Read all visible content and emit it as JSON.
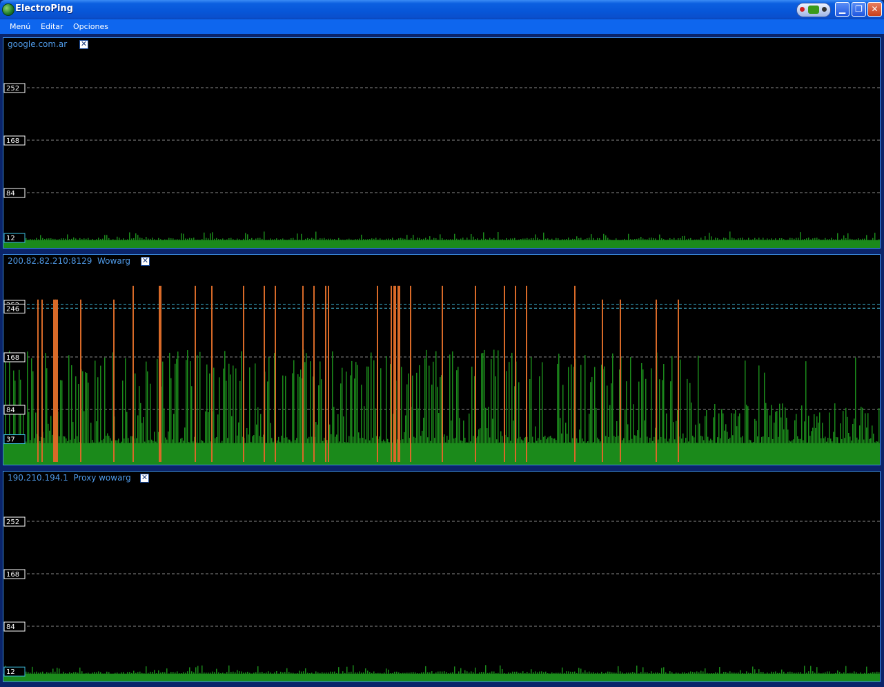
{
  "window": {
    "title": "ElectroPing",
    "minimize_glyph": "▁",
    "restore_glyph": "❐",
    "close_glyph": "✕"
  },
  "menu": [
    {
      "label": "Menú"
    },
    {
      "label": "Editar"
    },
    {
      "label": "Opciones"
    }
  ],
  "colors": {
    "accent": "#3c8ee8",
    "bar_green": "#1b8a1b",
    "spike_orange": "#d86a28",
    "grid": "#8a8a8a",
    "cyan_line": "#3bb8d8"
  },
  "panels": [
    {
      "title": "google.com.ar",
      "close_glyph": "✕",
      "chart_data": {
        "type": "bar",
        "y_ticks": [
          252,
          168,
          84
        ],
        "current_value": 12,
        "baseline_ms": 8,
        "spike_ms": [],
        "cyan_levels": []
      }
    },
    {
      "title": "200.82.82.210:8129  Wowarg",
      "close_glyph": "✕",
      "chart_data": {
        "type": "bar",
        "y_ticks": [
          252,
          246,
          168,
          84
        ],
        "current_value": 37,
        "baseline_ms": 30,
        "spike_ms": [
          282,
          282,
          282,
          282,
          282,
          282,
          282,
          282,
          282,
          282,
          282,
          282,
          282,
          282,
          282,
          282,
          282,
          282,
          282,
          282,
          282,
          282,
          282,
          282,
          282,
          282,
          282,
          282,
          282
        ],
        "cyan_levels": [
          252,
          246
        ]
      }
    },
    {
      "title": "190.210.194.1  Proxy wowarg",
      "close_glyph": "✕",
      "chart_data": {
        "type": "bar",
        "y_ticks": [
          252,
          168,
          84
        ],
        "current_value": 12,
        "baseline_ms": 8,
        "spike_ms": [],
        "cyan_levels": []
      }
    }
  ]
}
